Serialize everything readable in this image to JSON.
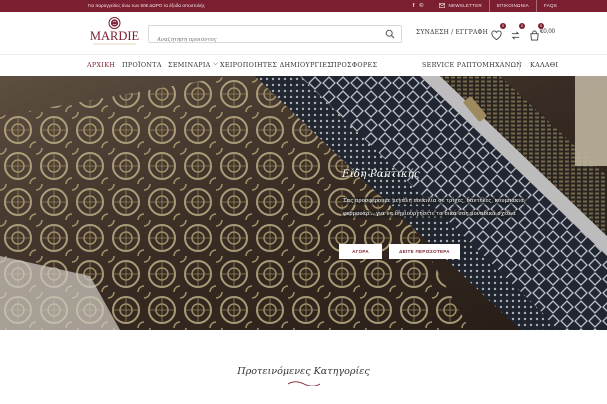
{
  "topbar": {
    "promo": "Για παραγγελίες άνω των 50€ ΔΩΡΟ τα έξοδα αποστολής",
    "social": [
      "f",
      "©"
    ],
    "links": [
      "NEWSLETTER",
      "ΕΠΙΚΟΙΝΩΝΙΑ",
      "FAQS"
    ]
  },
  "header": {
    "logo_text": "MARDIE",
    "search_placeholder": "Αναζήτηση προϊόντος",
    "login_label": "ΣΥΝΔΕΣΗ / ΕΓΓΡΑΦΗ",
    "wishlist_count": "0",
    "compare_count": "0",
    "cart_count": "0",
    "cart_total": "€0,00"
  },
  "nav": {
    "left": [
      "ΑΡΧΙΚΗ",
      "ΠΡΟΪΟΝΤΑ",
      "ΣΕΜΙΝΑΡΙΑ",
      "ΧΕΙΡΟΠΟΙΗΤΕΣ ΔΗΜΙΟΥΡΓΙΕΣ",
      "ΠΡΟΣΦΟΡΕΣ"
    ],
    "right": [
      "SERVICE ΡΑΠΤΟΜΗΧΑΝΩΝ",
      "ΚΑΛΑΘΙ"
    ]
  },
  "hero": {
    "title": "Είδη Ραπτικής",
    "description": "Σας προσφέρουμε μεγάλη ποικιλία σε τρίχες, δαντέλες, κουμπάκια, φερμουάρ... για να δημιουργήσετε τα δικά σας μοναδικά σχέδια",
    "shop_label": "ΑΓΟΡΑ",
    "more_label": "ΔΕΙΤΕ ΠΕΡΙΣΣΟΤΕΡΑ"
  },
  "featured": {
    "title": "Προτεινόμενες Κατηγορίες"
  },
  "colors": {
    "brand": "#7a1e30",
    "gold": "#c9b27a"
  }
}
